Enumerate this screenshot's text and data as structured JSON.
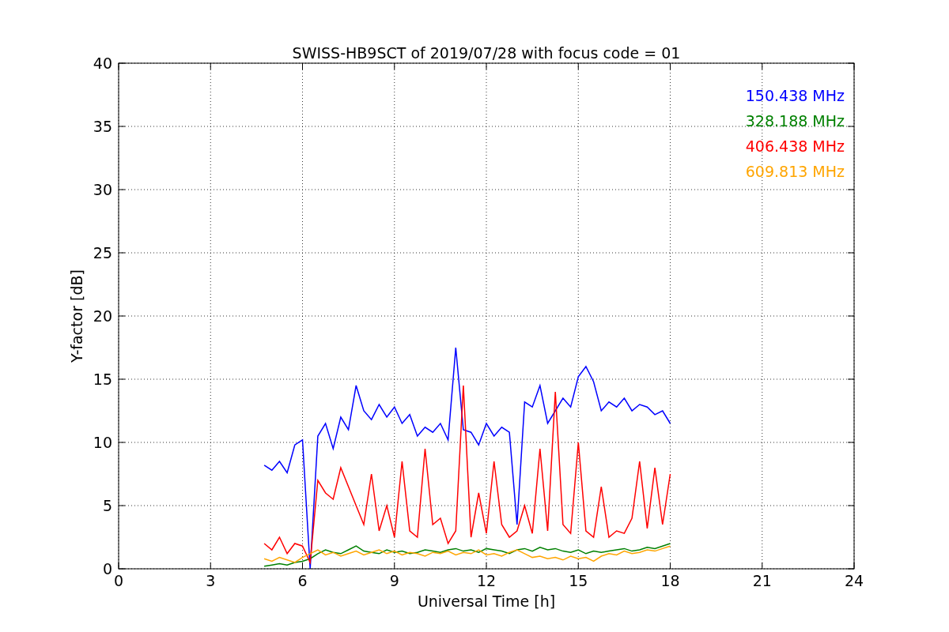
{
  "chart": {
    "chart_data": {
      "type": "line",
      "title": "SWISS-HB9SCT of 2019/07/28 with focus code = 01",
      "xlabel": "Universal Time [h]",
      "ylabel": "Y-factor [dB]",
      "x": [
        4.75,
        5,
        5.25,
        5.5,
        5.75,
        6,
        6.25,
        6.5,
        6.75,
        7,
        7.25,
        7.5,
        7.75,
        8,
        8.25,
        8.5,
        8.75,
        9,
        9.25,
        9.5,
        9.75,
        10,
        10.25,
        10.5,
        10.75,
        11,
        11.25,
        11.5,
        11.75,
        12,
        12.25,
        12.5,
        12.75,
        13,
        13.25,
        13.5,
        13.75,
        14,
        14.25,
        14.5,
        14.75,
        15,
        15.25,
        15.5,
        15.75,
        16,
        16.25,
        16.5,
        16.75,
        17,
        17.25,
        17.5,
        17.75,
        18
      ],
      "series": [
        {
          "name": "150.438 MHz",
          "color": "#0000ff",
          "values": [
            8.2,
            7.8,
            8.5,
            7.6,
            9.8,
            10.2,
            0,
            10.5,
            11.5,
            9.5,
            12,
            11,
            14.5,
            12.5,
            11.8,
            13,
            12,
            12.8,
            11.5,
            12.2,
            10.5,
            11.2,
            10.8,
            11.5,
            10.2,
            17.5,
            11,
            10.8,
            9.8,
            11.5,
            10.5,
            11.2,
            10.8,
            3.5,
            13.2,
            12.8,
            14.5,
            11.5,
            12.5,
            13.5,
            12.8,
            15.2,
            16,
            14.8,
            12.5,
            13.2,
            12.8,
            13.5,
            12.5,
            13,
            12.8,
            12.2,
            12.5,
            11.5
          ]
        },
        {
          "name": "328.188 MHz",
          "color": "#008000",
          "values": [
            0.2,
            0.3,
            0.4,
            0.3,
            0.5,
            0.6,
            0.8,
            1.2,
            1.5,
            1.3,
            1.2,
            1.5,
            1.8,
            1.4,
            1.3,
            1.2,
            1.5,
            1.3,
            1.4,
            1.2,
            1.3,
            1.5,
            1.4,
            1.3,
            1.5,
            1.6,
            1.4,
            1.5,
            1.3,
            1.6,
            1.5,
            1.4,
            1.2,
            1.5,
            1.6,
            1.4,
            1.7,
            1.5,
            1.6,
            1.4,
            1.3,
            1.5,
            1.2,
            1.4,
            1.3,
            1.4,
            1.5,
            1.6,
            1.4,
            1.5,
            1.7,
            1.6,
            1.8,
            2.0
          ]
        },
        {
          "name": "406.438 MHz",
          "color": "#ff0000",
          "values": [
            2,
            1.5,
            2.5,
            1.2,
            2,
            1.8,
            0.5,
            7,
            6,
            5.5,
            8,
            6.5,
            5,
            3.5,
            7.5,
            3,
            5,
            2.5,
            8.5,
            3,
            2.5,
            9.5,
            3.5,
            4,
            2,
            3,
            14.5,
            2.5,
            6,
            2.8,
            8.5,
            3.5,
            2.5,
            3,
            5,
            2.8,
            9.5,
            3,
            14,
            3.5,
            2.8,
            10,
            3,
            2.5,
            6.5,
            2.5,
            3,
            2.8,
            4,
            8.5,
            3.2,
            8,
            3.5,
            7.5
          ]
        },
        {
          "name": "609.813 MHz",
          "color": "#ffa500",
          "values": [
            0.8,
            0.6,
            0.9,
            0.7,
            0.5,
            0.9,
            1.2,
            1.5,
            1.1,
            1.3,
            1.0,
            1.2,
            1.4,
            1.1,
            1.3,
            1.5,
            1.2,
            1.4,
            1.1,
            1.3,
            1.2,
            1.0,
            1.3,
            1.2,
            1.4,
            1.1,
            1.3,
            1.2,
            1.5,
            1.1,
            1.2,
            1.0,
            1.3,
            1.5,
            1.2,
            0.9,
            1.0,
            0.8,
            0.9,
            0.7,
            1.0,
            0.8,
            0.9,
            0.6,
            1.0,
            1.2,
            1.1,
            1.4,
            1.2,
            1.3,
            1.5,
            1.4,
            1.6,
            1.8
          ]
        }
      ],
      "grid": true,
      "xlim": [
        0,
        24
      ],
      "ylim": [
        0,
        40
      ],
      "xticks": [
        0,
        3,
        6,
        9,
        12,
        15,
        18,
        21,
        24
      ],
      "yticks": [
        0,
        5,
        10,
        15,
        20,
        25,
        30,
        35,
        40
      ]
    }
  }
}
